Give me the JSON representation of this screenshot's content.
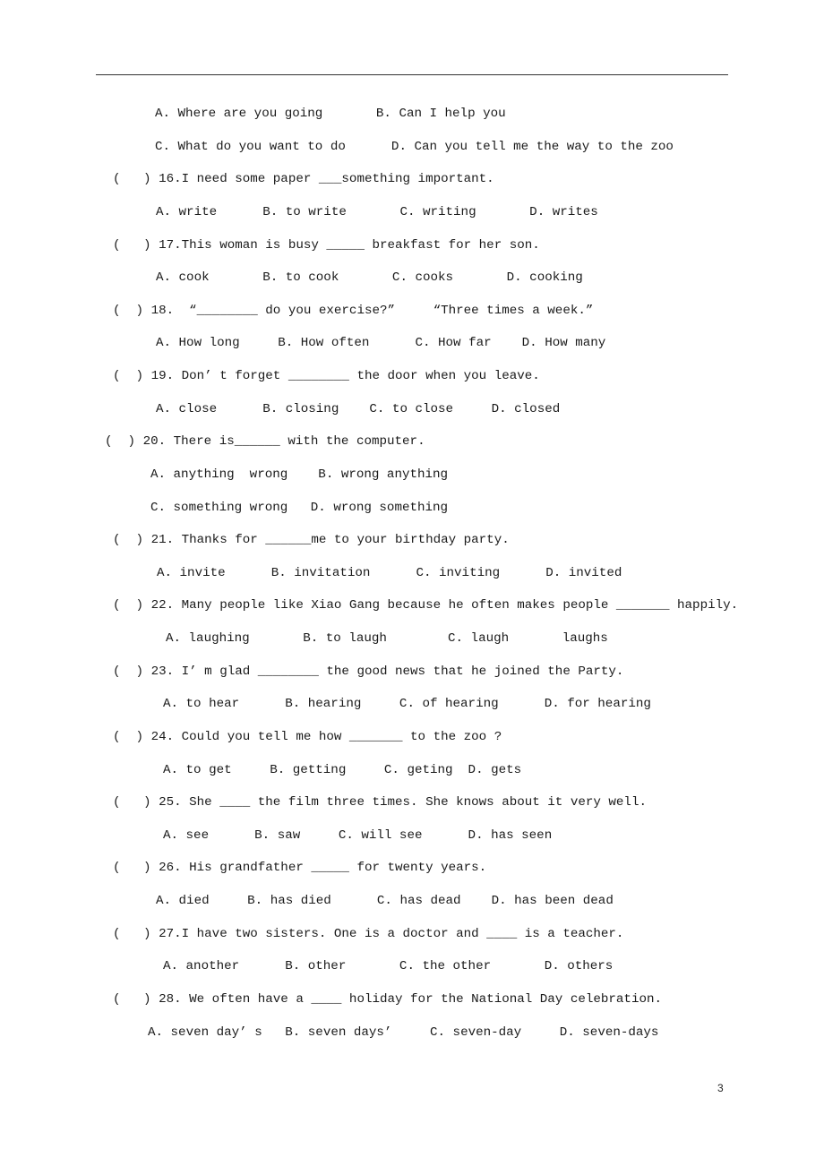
{
  "page": {
    "number": "3"
  },
  "lines": [
    {
      "id": "q15-opts-ab",
      "text": "A. Where are you going       B. Can I help you"
    },
    {
      "id": "q15-opts-cd",
      "text": "C. What do you want to do      D. Can you tell me the way to the zoo"
    },
    {
      "id": "q16",
      "text": "(   ) 16.I need some paper ___something important."
    },
    {
      "id": "q16-opts",
      "text": "A. write      B. to write       C. writing       D. writes"
    },
    {
      "id": "q17",
      "text": "(   ) 17.This woman is busy _____ breakfast for her son."
    },
    {
      "id": "q17-opts",
      "text": "A. cook       B. to cook       C. cooks       D. cooking"
    },
    {
      "id": "q18",
      "text": "(  ) 18.  “________ do you exercise?”     “Three times a week.”"
    },
    {
      "id": "q18-opts",
      "text": "A. How long     B. How often      C. How far    D. How many"
    },
    {
      "id": "q19",
      "text": "(  ) 19. Don’ t forget ________ the door when you leave."
    },
    {
      "id": "q19-opts",
      "text": "A. close      B. closing    C. to close     D. closed"
    },
    {
      "id": "q20",
      "text": "(  ) 20. There is______ with the computer."
    },
    {
      "id": "q20-opts-ab",
      "text": "A. anything  wrong    B. wrong anything"
    },
    {
      "id": "q20-opts-cd",
      "text": "C. something wrong   D. wrong something"
    },
    {
      "id": "q21",
      "text": "(  ) 21. Thanks for ______me to your birthday party."
    },
    {
      "id": "q21-opts",
      "text": "A. invite      B. invitation      C. inviting      D. invited"
    },
    {
      "id": "q22",
      "text": "(  ) 22. Many people like Xiao Gang because he often makes people _______ happily."
    },
    {
      "id": "q22-opts",
      "text": "A. laughing       B. to laugh        C. laugh       laughs"
    },
    {
      "id": "q23",
      "text": "(  ) 23. I’ m glad ________ the good news that he joined the Party."
    },
    {
      "id": "q23-opts",
      "text": "A. to hear      B. hearing     C. of hearing      D. for hearing"
    },
    {
      "id": "q24",
      "text": "(  ) 24. Could you tell me how _______ to the zoo ?"
    },
    {
      "id": "q24-opts",
      "text": "A. to get     B. getting     C. geting  D. gets"
    },
    {
      "id": "q25",
      "text": "(   ) 25. She ____ the film three times. She knows about it very well."
    },
    {
      "id": "q25-opts",
      "text": "A. see      B. saw     C. will see      D. has seen"
    },
    {
      "id": "q26",
      "text": "(   ) 26. His grandfather _____ for twenty years."
    },
    {
      "id": "q26-opts",
      "text": "A. died     B. has died      C. has dead    D. has been dead"
    },
    {
      "id": "q27",
      "text": "(   ) 27.I have two sisters. One is a doctor and ____ is a teacher."
    },
    {
      "id": "q27-opts",
      "text": "A. another      B. other       C. the other       D. others"
    },
    {
      "id": "q28",
      "text": "(   ) 28. We often have a ____ holiday for the National Day celebration."
    },
    {
      "id": "q28-opts",
      "text": "A. seven day’ s   B. seven days’     C. seven-day     D. seven-days"
    }
  ]
}
